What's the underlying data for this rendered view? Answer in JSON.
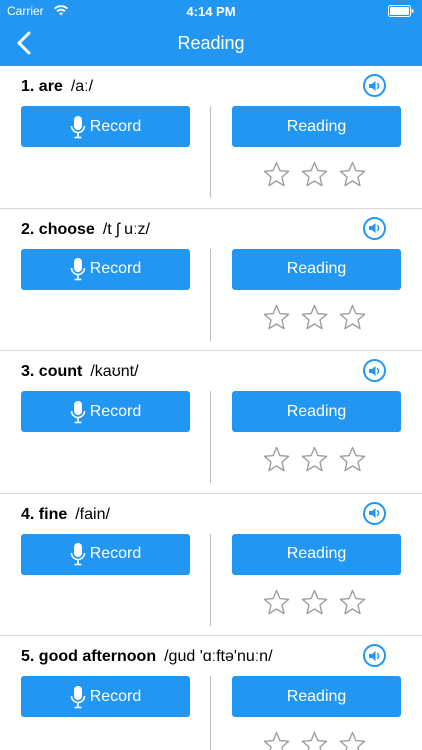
{
  "status": {
    "carrier": "Carrier",
    "time": "4:14 PM"
  },
  "nav": {
    "title": "Reading"
  },
  "items": [
    {
      "word": "1. are",
      "phonetic": "/aː/",
      "record_label": "Record",
      "reading_label": "Reading",
      "stars": 0
    },
    {
      "word": "2. choose",
      "phonetic": "/t ʃ uːz/",
      "record_label": "Record",
      "reading_label": "Reading",
      "stars": 0
    },
    {
      "word": "3. count",
      "phonetic": "/kaʊnt/",
      "record_label": "Record",
      "reading_label": "Reading",
      "stars": 0
    },
    {
      "word": "4. fine",
      "phonetic": "/fain/",
      "record_label": "Record",
      "reading_label": "Reading",
      "stars": 0
    },
    {
      "word": "5. good afternoon",
      "phonetic": "/gud 'ɑːftə'nuːn/",
      "record_label": "Record",
      "reading_label": "Reading",
      "stars": 0
    }
  ],
  "colors": {
    "accent": "#2196f3",
    "star_outline": "#9e9e9e",
    "divider": "#d6d6d6"
  }
}
